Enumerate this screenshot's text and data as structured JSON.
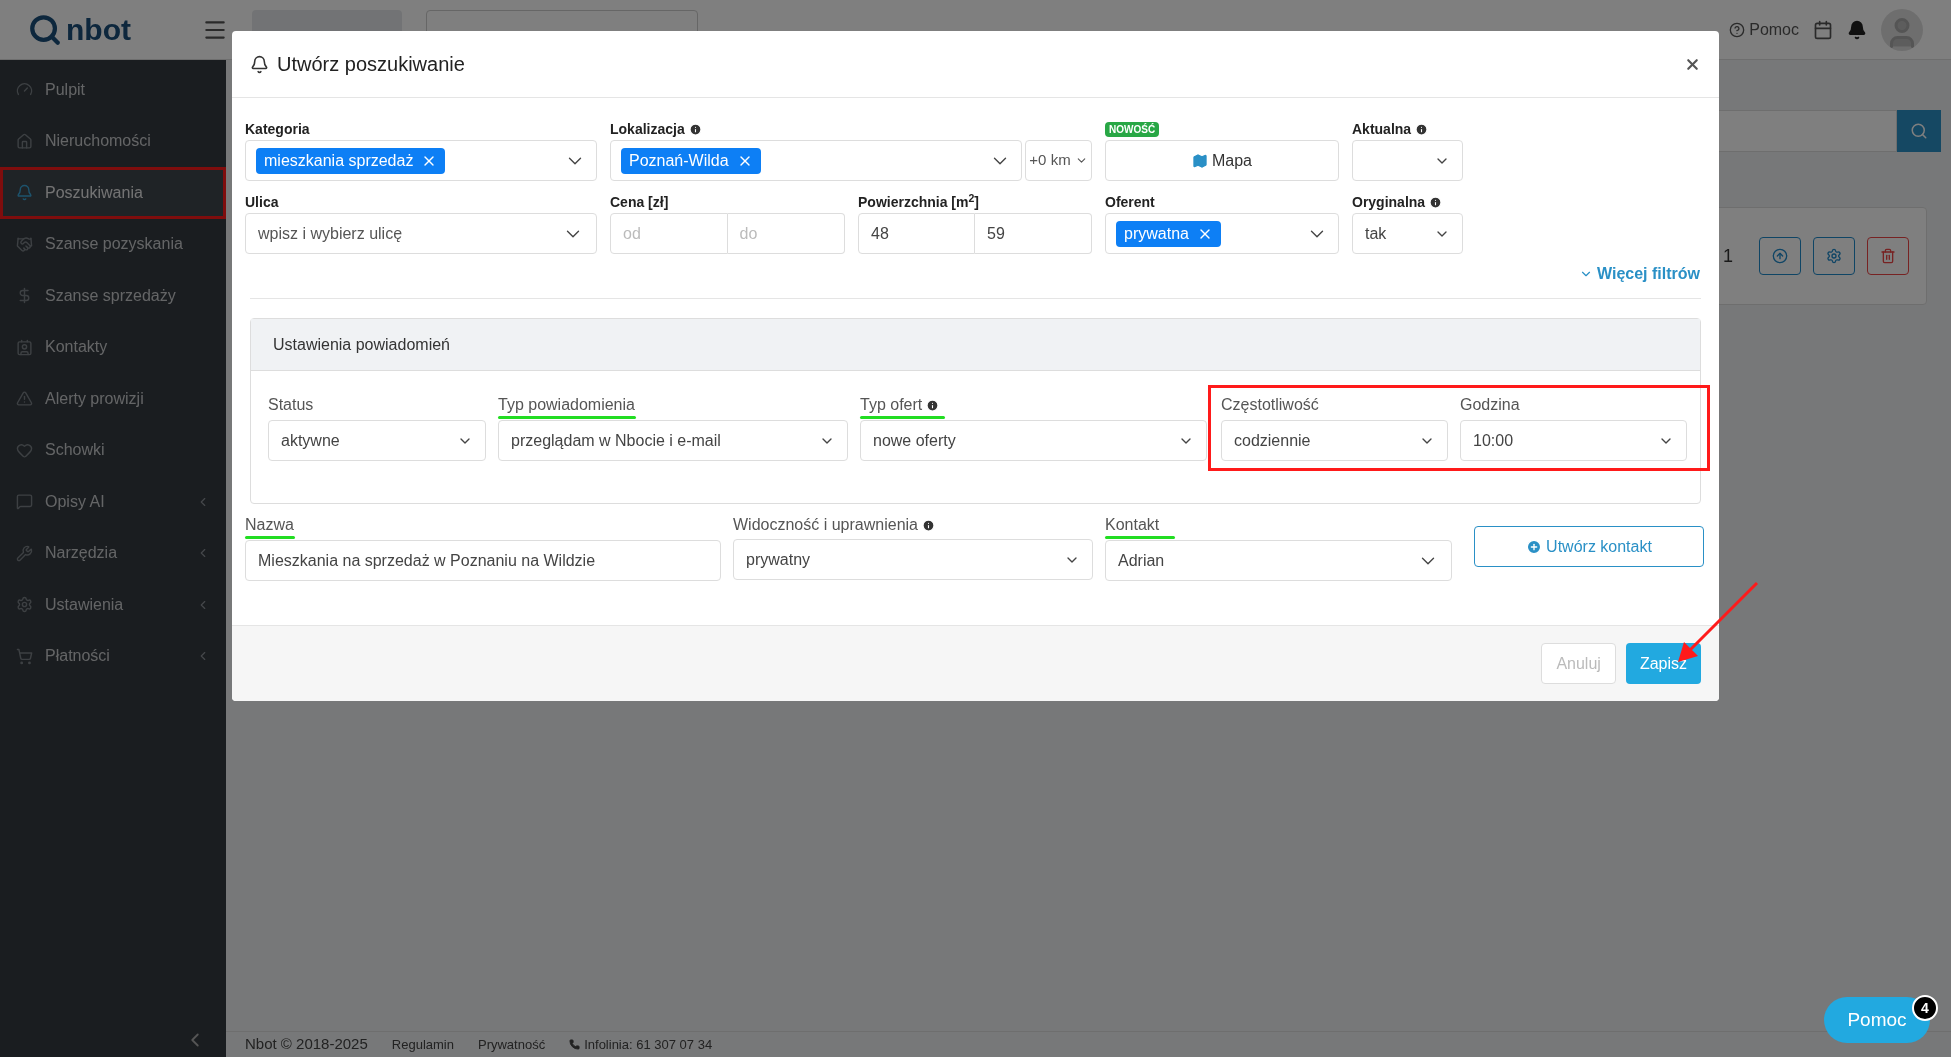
{
  "topbar": {
    "logo": "nbot",
    "help": "Pomoc"
  },
  "sidebar": {
    "items": [
      {
        "label": "Pulpit",
        "selected": false,
        "expandable": false
      },
      {
        "label": "Nieruchomości",
        "selected": false,
        "expandable": false
      },
      {
        "label": "Poszukiwania",
        "selected": true,
        "expandable": false
      },
      {
        "label": "Szanse pozyskania",
        "selected": false,
        "expandable": false
      },
      {
        "label": "Szanse sprzedaży",
        "selected": false,
        "expandable": false
      },
      {
        "label": "Kontakty",
        "selected": false,
        "expandable": false
      },
      {
        "label": "Alerty prowizji",
        "selected": false,
        "expandable": false
      },
      {
        "label": "Schowki",
        "selected": false,
        "expandable": false
      },
      {
        "label": "Opisy AI",
        "selected": false,
        "expandable": true
      },
      {
        "label": "Narzędzia",
        "selected": false,
        "expandable": true
      },
      {
        "label": "Ustawienia",
        "selected": false,
        "expandable": true
      },
      {
        "label": "Płatności",
        "selected": false,
        "expandable": true
      }
    ]
  },
  "background": {
    "card_count": "1"
  },
  "modal": {
    "title": "Utwórz poszukiwanie",
    "filters": {
      "kategoria": {
        "label": "Kategoria",
        "tags": [
          "mieszkania sprzedaż"
        ]
      },
      "lokalizacja": {
        "label": "Lokalizacja",
        "tags": [
          "Poznań-Wilda"
        ],
        "radius": "+0 km"
      },
      "mapa": {
        "badge": "NOWOŚĆ",
        "button": "Mapa"
      },
      "aktualna": {
        "label": "Aktualna"
      },
      "ulica": {
        "label": "Ulica",
        "placeholder": "wpisz i wybierz ulicę"
      },
      "cena": {
        "label": "Cena [zł]",
        "from_placeholder": "od",
        "to_placeholder": "do"
      },
      "powierzchnia": {
        "label": "Powierzchnia [m$^{2}$]",
        "from": "48",
        "to": "59"
      },
      "oferent": {
        "label": "Oferent",
        "tags": [
          "prywatna"
        ]
      },
      "oryginalna": {
        "label": "Oryginalna",
        "value": "tak"
      },
      "more": "Więcej filtrów"
    },
    "notifications": {
      "title": "Ustawienia powiadomień",
      "fields": [
        {
          "label": "Status",
          "value": "aktywne",
          "info": false,
          "underlined": false
        },
        {
          "label": "Typ powiadomienia",
          "value": "przeglądam w Nbocie i e-mail",
          "info": false,
          "underlined": true
        },
        {
          "label": "Typ ofert",
          "value": "nowe oferty",
          "info": true,
          "underlined": true
        },
        {
          "label": "Częstotliwość",
          "value": "codziennie",
          "info": false,
          "underlined": false
        },
        {
          "label": "Godzina",
          "value": "10:00",
          "info": false,
          "underlined": false
        }
      ]
    },
    "name": {
      "label": "Nazwa",
      "value": "Mieszkania na sprzedaż w Poznaniu na Wildzie"
    },
    "visibility": {
      "label": "Widoczność i uprawnienia",
      "value": "prywatny"
    },
    "contact": {
      "label": "Kontakt",
      "value": "Adrian",
      "button": "Utwórz kontakt"
    },
    "buttons": {
      "cancel": "Anuluj",
      "save": "Zapisz"
    }
  },
  "footer": {
    "copyright": "Nbot © 2018-2025",
    "links": [
      "Regulamin",
      "Prywatność"
    ],
    "phone": "Infolinia: 61 307 07 34"
  },
  "help_button": {
    "label": "Pomoc",
    "badge": "4"
  }
}
